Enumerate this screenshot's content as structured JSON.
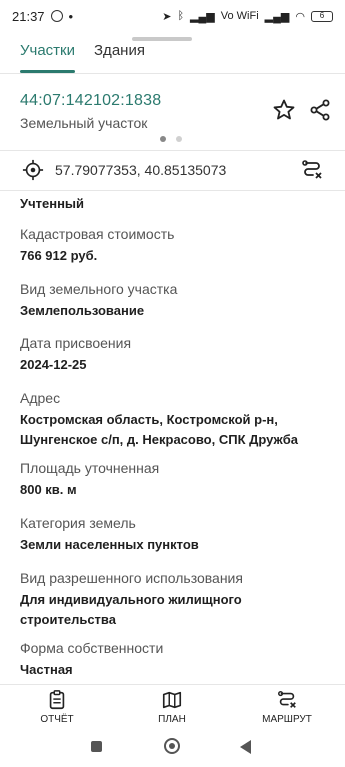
{
  "status_bar": {
    "time": "21:37",
    "battery": "6",
    "network": "Vo WiFi"
  },
  "tabs": [
    {
      "label": "Участки",
      "active": true
    },
    {
      "label": "Здания",
      "active": false
    }
  ],
  "parcel": {
    "cadastral_number": "44:07:142102:1838",
    "type": "Земельный участок"
  },
  "coordinates": "57.79077353, 40.85135073",
  "properties": [
    {
      "label": "",
      "value": "Учтенный"
    },
    {
      "label": "Кадастровая стоимость",
      "value": "766 912 руб."
    },
    {
      "label": "Вид земельного участка",
      "value": "Землепользование"
    },
    {
      "label": "Дата присвоения",
      "value": "2024-12-25"
    },
    {
      "label": "Адрес",
      "value": "Костромская область, Костромской р-н, Шунгенское с/п, д. Некрасово, СПК Дружба"
    },
    {
      "label": "Площадь уточненная",
      "value": "800 кв. м"
    },
    {
      "label": "Категория земель",
      "value": "Земли населенных пунктов"
    },
    {
      "label": "Вид разрешенного использования",
      "value": "Для индивидуального жилищного строительства"
    },
    {
      "label": "Форма собственности",
      "value": "Частная"
    }
  ],
  "bottom_nav": [
    {
      "label": "ОТЧЁТ",
      "icon": "report-icon"
    },
    {
      "label": "ПЛАН",
      "icon": "map-icon"
    },
    {
      "label": "МАРШРУТ",
      "icon": "route-icon"
    }
  ],
  "colors": {
    "accent": "#2b7a6e",
    "text": "#1f1f1f",
    "muted": "#555555"
  }
}
